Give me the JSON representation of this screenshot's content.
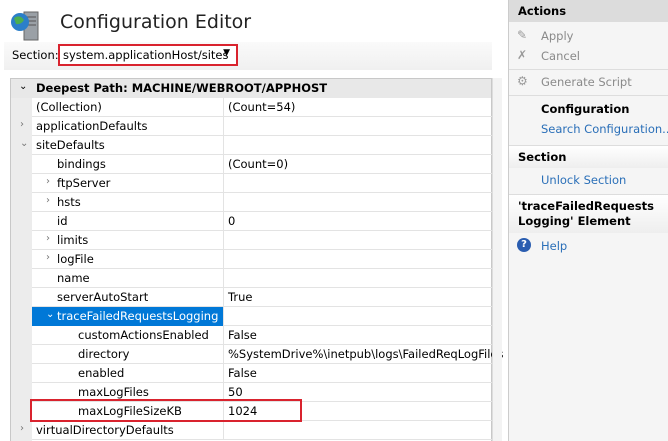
{
  "header": {
    "title": "Configuration Editor",
    "section_label": "Section:",
    "section_value": "system.applicationHost/sites"
  },
  "grid": {
    "deepest_path": "Deepest Path: MACHINE/WEBROOT/APPHOST",
    "rows": [
      {
        "name": "(Collection)",
        "value": "(Count=54)",
        "level": 0,
        "exp": ""
      },
      {
        "name": "applicationDefaults",
        "value": "",
        "level": 0,
        "exp": ">"
      },
      {
        "name": "siteDefaults",
        "value": "",
        "level": 0,
        "exp": "v"
      },
      {
        "name": "bindings",
        "value": "(Count=0)",
        "level": 1,
        "exp": ""
      },
      {
        "name": "ftpServer",
        "value": "",
        "level": 1,
        "exp": ">"
      },
      {
        "name": "hsts",
        "value": "",
        "level": 1,
        "exp": ">"
      },
      {
        "name": "id",
        "value": "0",
        "level": 1,
        "exp": ""
      },
      {
        "name": "limits",
        "value": "",
        "level": 1,
        "exp": ">"
      },
      {
        "name": "logFile",
        "value": "",
        "level": 1,
        "exp": ">"
      },
      {
        "name": "name",
        "value": "",
        "level": 1,
        "exp": ""
      },
      {
        "name": "serverAutoStart",
        "value": "True",
        "level": 1,
        "exp": ""
      },
      {
        "name": "traceFailedRequestsLogging",
        "value": "",
        "level": 1,
        "exp": "v",
        "selected": true
      },
      {
        "name": "customActionsEnabled",
        "value": "False",
        "level": 2,
        "exp": ""
      },
      {
        "name": "directory",
        "value": "%SystemDrive%\\inetpub\\logs\\FailedReqLogFiles",
        "level": 2,
        "exp": ""
      },
      {
        "name": "enabled",
        "value": "False",
        "level": 2,
        "exp": ""
      },
      {
        "name": "maxLogFiles",
        "value": "50",
        "level": 2,
        "exp": ""
      },
      {
        "name": "maxLogFileSizeKB",
        "value": "1024",
        "level": 2,
        "exp": ""
      },
      {
        "name": "virtualDirectoryDefaults",
        "value": "",
        "level": 0,
        "exp": ">"
      }
    ]
  },
  "actions": {
    "title": "Actions",
    "apply": "Apply",
    "cancel": "Cancel",
    "generate_script": "Generate Script",
    "configuration": "Configuration",
    "search_configuration": "Search Configuration...",
    "section": "Section",
    "unlock_section": "Unlock Section",
    "element_title": "'traceFailedRequestsLogging' Element",
    "help": "Help"
  }
}
